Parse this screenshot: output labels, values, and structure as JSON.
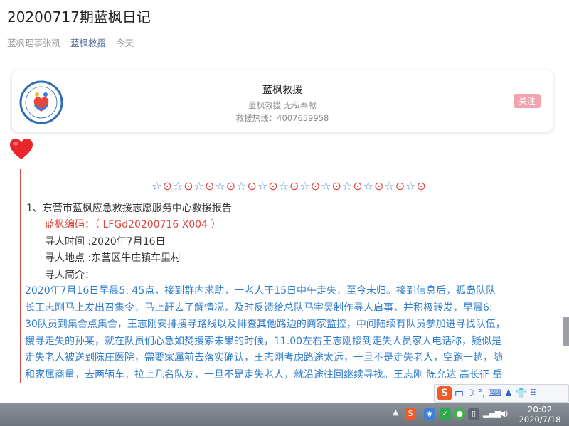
{
  "article": {
    "title": "20200717期蓝枫日记",
    "author": "蓝枫理事张凯",
    "account": "蓝枫救援",
    "date": "今天"
  },
  "card": {
    "name": "蓝枫救援",
    "slogan": "蓝枫救援  无私奉献",
    "hotline": "救援热线：4007659958",
    "follow_label": "关注",
    "logo_name": "blue-maple-rescue-logo",
    "logo_text": "东营市蓝枫应急救援志愿服务中心",
    "logo_phone": "4007659958"
  },
  "content": {
    "decoration": "☆⊙☆⊙☆⊙☆⊙☆⊙☆⊙☆⊙☆⊙☆⊙☆⊙☆⊙☆⊙☆⊙",
    "heading": "1、东营市蓝枫应急救援志愿服务中心救援报告",
    "code": "蓝枫编码：（ LFGd20200716 X004 ）",
    "time": "寻人时间 :2020年7月16日",
    "place": "寻人地点 :东营区牛庄镇车里村",
    "intro_label": "寻人简介：",
    "body_lines": [
      "2020年7月16日早晨5: 45点，接到群内求助，一老人于15日中午走失，至今未归。接到信息后，孤岛队队",
      "长王志刚马上发出召集令，马上赶去了解情况，及时反馈给总队马宇昊制作寻人启事，并积极转发，早晨6:",
      "30队员到集合点集合，王志刚安排搜寻路线以及排查其他路边的商家监控，中间陆续有队员参加进寻找队伍，",
      "搜寻走失的孙某，就在队员们心急如焚搜索未果的时候，11.00左右王志刚接到走失人员家人电话称，疑似是",
      "走失老人被送到陈庄医院，需要家属前去落实确认，王志刚考虑路途太远，一旦不是走失老人，空跑一趟，随",
      "和家属商量，去两辆车，拉上几名队友，一旦不是走失老人，就沿途往回继续寻找。王志刚 陈允达 高长征 岳"
    ]
  },
  "ime": {
    "logo": "S",
    "items": [
      "中",
      "☽",
      "°,",
      "⌨",
      "♟",
      "👕",
      "⠿"
    ]
  },
  "taskbar": {
    "time": "20:02",
    "date": "2020/7/18",
    "tray_icons": [
      "sogou-tray-icon",
      "shield-tray-icon",
      "security-tray-icon",
      "wechat-tray-icon",
      "usb-tray-icon",
      "signal-tray-icon",
      "volume-tray-icon"
    ]
  },
  "colors": {
    "accent_link": "#576b95",
    "report_red": "#e0443e",
    "body_blue": "#2f7dcc",
    "follow_pink": "#f1a4b0"
  }
}
